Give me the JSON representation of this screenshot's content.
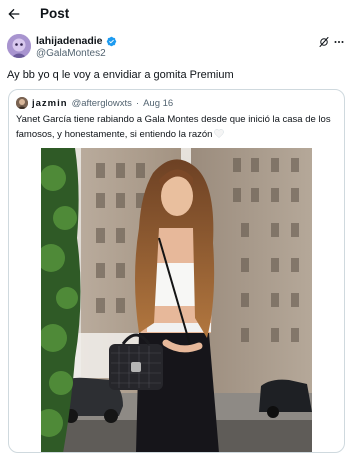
{
  "header": {
    "title": "Post",
    "back_icon": "arrow-left-icon"
  },
  "post": {
    "author": {
      "display_name": "lahijadenadie",
      "handle": "@GalaMontes2",
      "verified": true
    },
    "text": "Ay bb yo q le voy a envidiar a  gomita Premium",
    "actions": [
      "grok-icon",
      "more-icon"
    ]
  },
  "quoted_post": {
    "author_name": "jazmin",
    "handle": "@afterglowxts",
    "separator": "·",
    "date": "Aug 16",
    "text": "Yanet García tiene rabiando a Gala Montes desde que inició la casa de los famosos, y honestamente, si entiendo la razón",
    "emoji": "white-heart"
  },
  "colors": {
    "text_primary": "#0f1419",
    "text_secondary": "#536471",
    "verified_blue": "#1d9bf0",
    "border": "#cfd9de"
  }
}
